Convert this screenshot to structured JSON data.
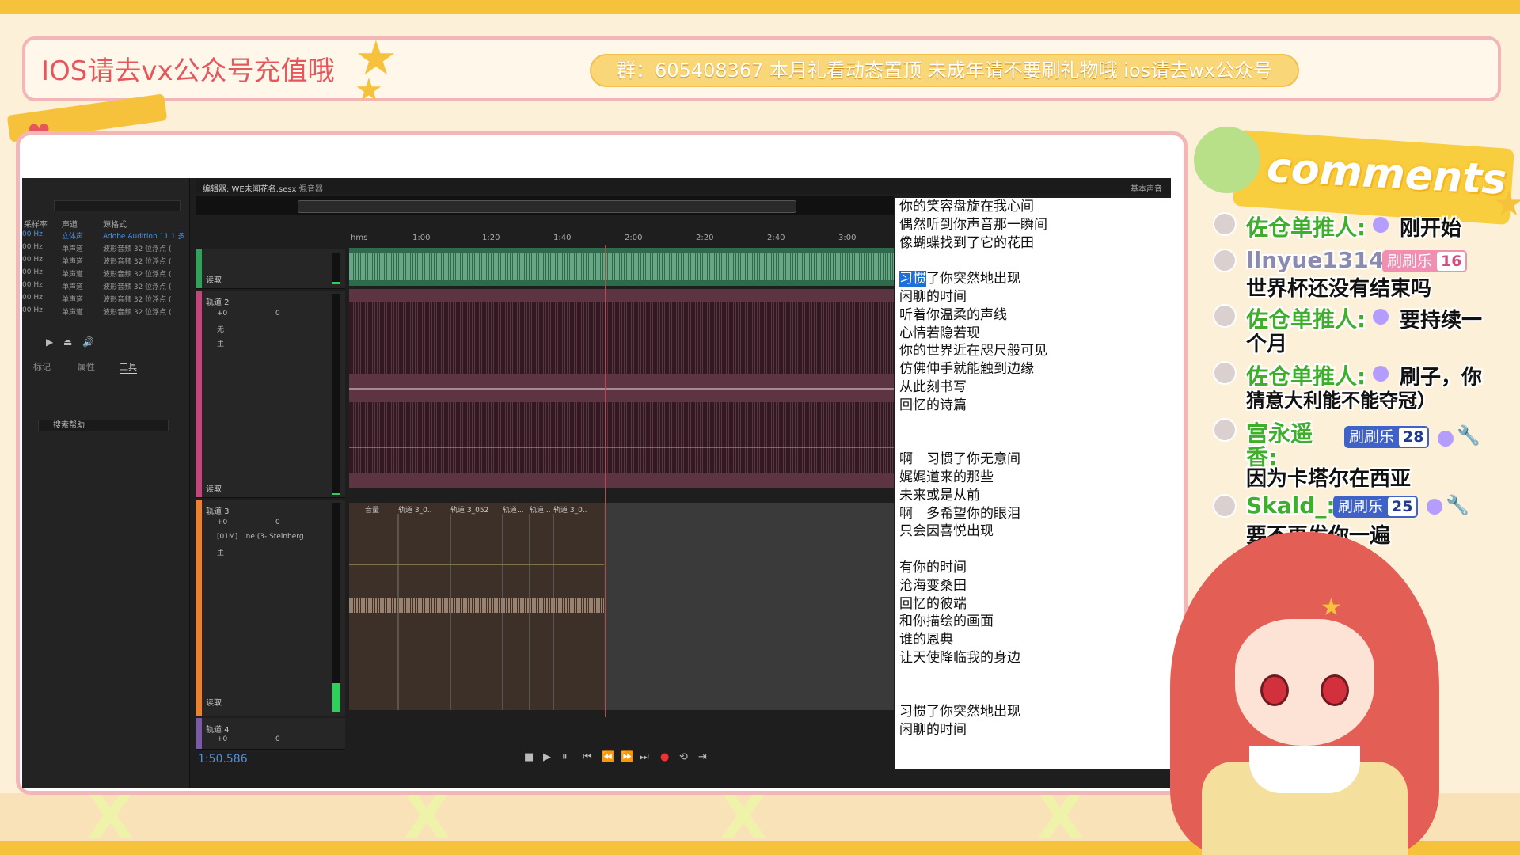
{
  "stream": {
    "title": "IOS请去vx公众号充值哦",
    "banner": "群：605408367 本月礼看动态置顶 未成年请不要刷礼物哦 ios请去wx公众号",
    "comments_title": "comments"
  },
  "audition": {
    "tabs": [
      "编辑器: WE未闻花名.sesx *",
      "混音器"
    ],
    "right_panel_title": "基本声音",
    "file_columns": [
      "采样率",
      "声道",
      "源格式"
    ],
    "files": [
      {
        "rate": "00 Hz",
        "channel": "立体声",
        "format": "Adobe Audition 11.1 多"
      },
      {
        "rate": "00 Hz",
        "channel": "单声道",
        "format": "波形音频 32 位浮点 ("
      },
      {
        "rate": "00 Hz",
        "channel": "单声道",
        "format": "波形音频 32 位浮点 ("
      },
      {
        "rate": "00 Hz",
        "channel": "单声道",
        "format": "波形音频 32 位浮点 ("
      },
      {
        "rate": "00 Hz",
        "channel": "单声道",
        "format": "波形音频 32 位浮点 ("
      },
      {
        "rate": "00 Hz",
        "channel": "单声道",
        "format": "波形音频 32 位浮点 ("
      },
      {
        "rate": "00 Hz",
        "channel": "单声道",
        "format": "波形音频 32 位浮点 ("
      }
    ],
    "panel_tabs": [
      "标记",
      "属性",
      "工具"
    ],
    "help_search_placeholder": "搜索帮助",
    "ruler": [
      "hms",
      "1:00",
      "1:20",
      "1:40",
      "2:00",
      "2:20",
      "2:40",
      "3:00"
    ],
    "tracks": [
      {
        "read": "读取",
        "color": "#2fa35a"
      },
      {
        "name": "轨道 2",
        "vol": "+0",
        "pan": "0",
        "input": "无",
        "output": "主",
        "read": "读取",
        "color": "#c5447a"
      },
      {
        "name": "轨道 3",
        "vol": "+0",
        "pan": "0",
        "input": "[01M] Line (3- Steinberg",
        "output": "主",
        "read": "读取",
        "color": "#f0812b"
      },
      {
        "name": "轨道 4",
        "vol": "+0",
        "pan": "0",
        "color": "#7a5aa8"
      }
    ],
    "clip_labels": [
      "音量",
      "轨道 3_0..",
      "轨道 3_052",
      "轨道...",
      "轨道...",
      "轨道 3_0.."
    ],
    "time": "1:50.586",
    "transport": [
      "■",
      "▶",
      "⏸",
      "⏮",
      "⏪",
      "⏩",
      "⏭",
      "●",
      "⟲",
      "⇥"
    ]
  },
  "lyrics": {
    "lines": [
      "你的笑容盘旋在我心间",
      "偶然听到你声音那一瞬间",
      "像蝴蝶找到了它的花田",
      "",
      "了你突然地出现",
      "闲聊的时间",
      "听着你温柔的声线",
      "心情若隐若现",
      "你的世界近在咫尺般可见",
      "仿佛伸手就能触到边缘",
      "从此刻书写",
      "回忆的诗篇",
      "",
      "",
      "啊　习惯了你无意间",
      "娓娓道来的那些",
      "未来或是从前",
      "啊　多希望你的眼泪",
      "只会因喜悦出现",
      "",
      "有你的时间",
      "沧海变桑田",
      "回忆的彼端",
      "和你描绘的画面",
      "谁的恩典",
      "让天使降临我的身边",
      "",
      "",
      "习惯了你突然地出现",
      "闲聊的时间"
    ],
    "highlight": "习惯"
  },
  "comments": [
    {
      "user": "佐仓单推人:",
      "text": "刚开始",
      "badge": null
    },
    {
      "user": "llnyue1314:",
      "text": "世界杯还没有结束吗",
      "badge": {
        "label": "刷刷乐",
        "level": "16",
        "style": "pink"
      }
    },
    {
      "user": "佐仓单推人:",
      "text": "要持续一",
      "text2": "个月",
      "badge": null
    },
    {
      "user": "佐仓单推人:",
      "text": "刷子，你",
      "text2": "猜意大利能不能夺冠）",
      "badge": null
    },
    {
      "user": "宫永遥",
      "user2": "香:",
      "text": "因为卡塔尔在西亚",
      "badge": {
        "label": "刷刷乐",
        "level": "28",
        "style": "blue"
      }
    },
    {
      "user": "Skald_:",
      "text": "要不再发你一遍",
      "badge": {
        "label": "刷刷乐",
        "level": "25",
        "style": "blue"
      }
    }
  ]
}
